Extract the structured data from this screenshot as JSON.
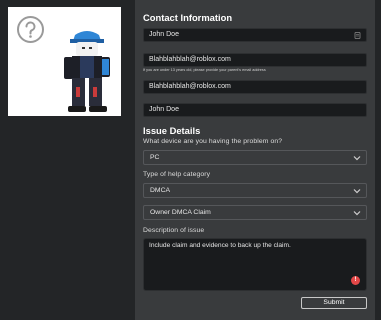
{
  "contact": {
    "heading": "Contact Information",
    "name_value": "John Doe",
    "email_value": "Blahblahblah@roblox.com",
    "email_hint": "If you are under 13 years old, please provide your parent's email address",
    "confirm_email_value": "Blahblahblah@roblox.com",
    "username_value": "John Doe"
  },
  "issue": {
    "heading": "Issue Details",
    "device_label": "What device are you having the problem on?",
    "device_value": "PC",
    "help_category_label": "Type of help category",
    "help_category_value": "DMCA",
    "subcategory_value": "Owner DMCA Claim",
    "description_label": "Description of issue",
    "description_value": "Include claim and evidence to back up the claim.",
    "grammar_badge": "!"
  },
  "actions": {
    "submit_label": "Submit"
  },
  "colors": {
    "page_bg": "#232527",
    "panel_bg": "#393b3d",
    "input_bg": "#191b1d",
    "alert": "#e34848"
  },
  "icons": [
    "help-question-icon",
    "id-card-icon",
    "chevron-down-icon"
  ]
}
